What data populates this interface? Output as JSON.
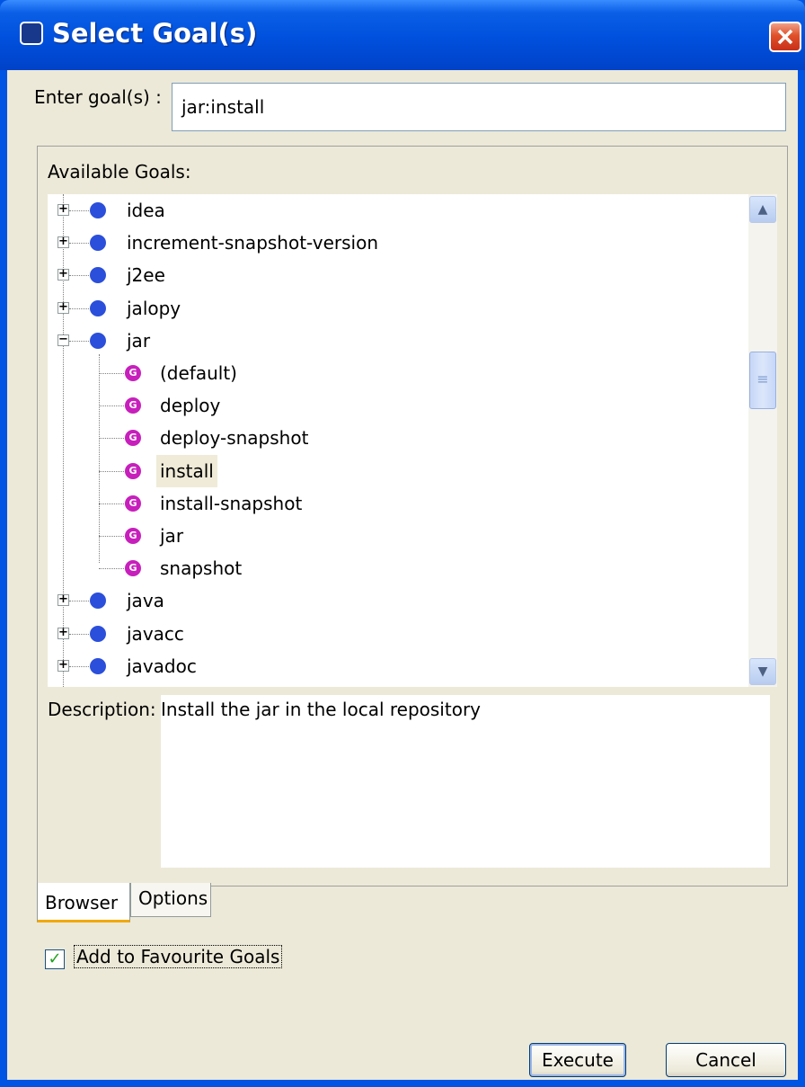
{
  "window": {
    "title": "Select Goal(s)"
  },
  "goal_input": {
    "label": "Enter goal(s) :",
    "value": "jar:install"
  },
  "available": {
    "label": "Available Goals:",
    "items": [
      {
        "label": "idea",
        "kind": "plugin",
        "expander": "+"
      },
      {
        "label": "increment-snapshot-version",
        "kind": "plugin",
        "expander": "+"
      },
      {
        "label": "j2ee",
        "kind": "plugin",
        "expander": "+"
      },
      {
        "label": "jalopy",
        "kind": "plugin",
        "expander": "+"
      },
      {
        "label": "jar",
        "kind": "plugin",
        "expander": "−"
      },
      {
        "label": "(default)",
        "kind": "goal"
      },
      {
        "label": "deploy",
        "kind": "goal"
      },
      {
        "label": "deploy-snapshot",
        "kind": "goal"
      },
      {
        "label": "install",
        "kind": "goal",
        "selected": true
      },
      {
        "label": "install-snapshot",
        "kind": "goal"
      },
      {
        "label": "jar",
        "kind": "goal"
      },
      {
        "label": "snapshot",
        "kind": "goal"
      },
      {
        "label": "java",
        "kind": "plugin",
        "expander": "+"
      },
      {
        "label": "javacc",
        "kind": "plugin",
        "expander": "+"
      },
      {
        "label": "javadoc",
        "kind": "plugin",
        "expander": "+"
      }
    ],
    "goal_icon": "G"
  },
  "description": {
    "label": "Description:",
    "text": "Install the jar in the local repository"
  },
  "tabs": {
    "browser": "Browser",
    "options": "Options"
  },
  "favourite": {
    "label": "Add to Favourite Goals",
    "checked": true,
    "mark": "✓"
  },
  "buttons": {
    "execute": "Execute",
    "cancel": "Cancel"
  },
  "scrollbar": {
    "up": "▲",
    "down": "▼",
    "grip": "≡"
  }
}
